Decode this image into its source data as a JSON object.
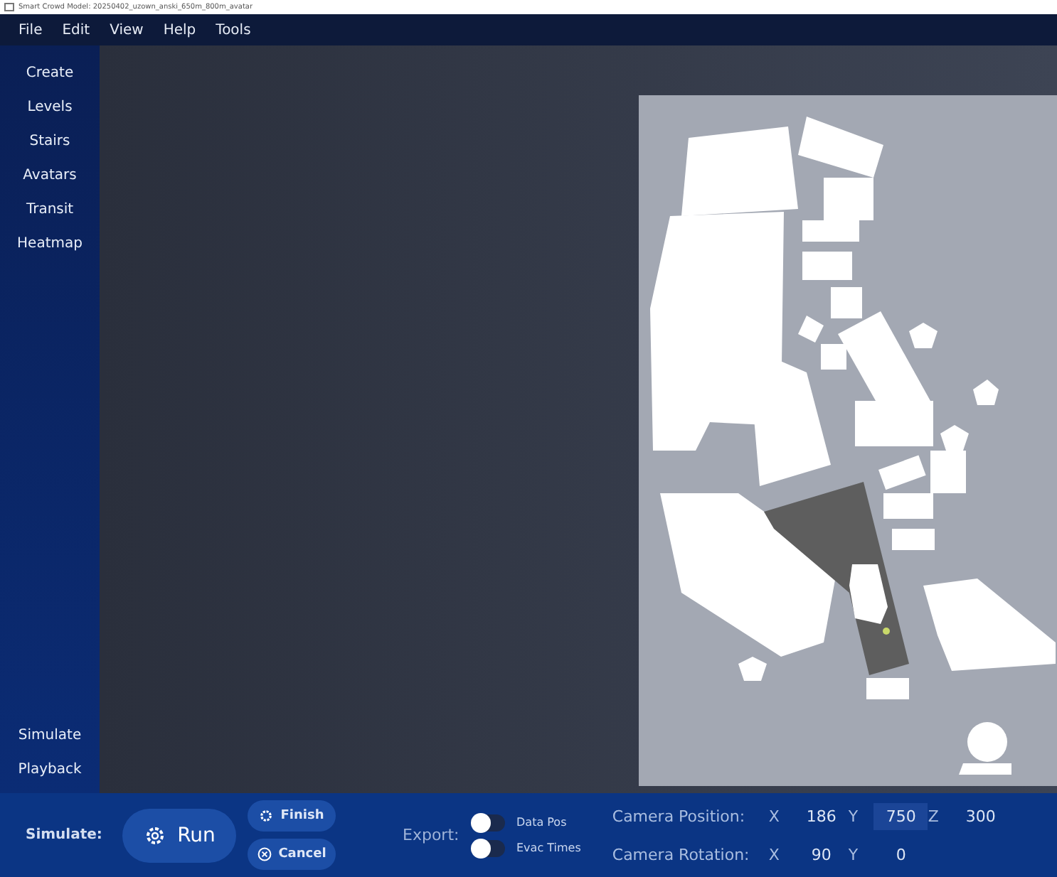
{
  "window": {
    "title": "Smart Crowd Model: 20250402_uzown_anski_650m_800m_avatar"
  },
  "menu": [
    "File",
    "Edit",
    "View",
    "Help",
    "Tools"
  ],
  "sidebar": {
    "items": [
      {
        "label": "Create",
        "selected": false
      },
      {
        "label": "Levels",
        "selected": false
      },
      {
        "label": "Stairs",
        "selected": false
      },
      {
        "label": "Avatars",
        "selected": false
      },
      {
        "label": "Transit",
        "selected": false
      },
      {
        "label": "Heatmap",
        "selected": false
      }
    ],
    "bottom_items": [
      {
        "label": "Simulate",
        "selected": false
      },
      {
        "label": "Playback",
        "selected": false
      }
    ]
  },
  "viewport": {
    "kind": "picture"
  },
  "bottom_bar": {
    "simulate_label": "Simulate:",
    "run": "Run",
    "finish": "Finish",
    "cancel": "Cancel",
    "export_label": "Export:",
    "toggles": [
      {
        "label": "Data Pos",
        "on": false
      },
      {
        "label": "Evac Times",
        "on": false
      }
    ],
    "camera": [
      {
        "label": "Camera Position:",
        "fields": [
          {
            "axis": "X",
            "value": "186",
            "focused": false
          },
          {
            "axis": "Y",
            "value": "750",
            "focused": true
          },
          {
            "axis": "Z",
            "value": "300",
            "focused": false
          }
        ]
      },
      {
        "label": "Camera Rotation:",
        "fields": [
          {
            "axis": "X",
            "value": "90",
            "focused": false
          },
          {
            "axis": "Y",
            "value": "0",
            "focused": false
          }
        ]
      }
    ]
  }
}
